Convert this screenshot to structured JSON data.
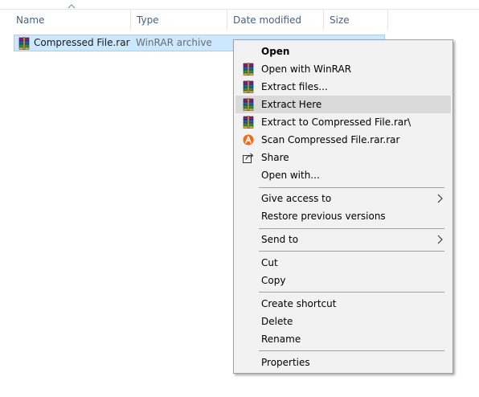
{
  "columns": {
    "name": "Name",
    "type": "Type",
    "date_modified": "Date modified",
    "size": "Size"
  },
  "sort": {
    "column": "name",
    "direction": "ascending"
  },
  "file": {
    "name": "Compressed File.rar",
    "type": "WinRAR archive",
    "icon": "winrar-archive-icon",
    "selected": true
  },
  "context_menu": {
    "hovered_item": "Extract Here",
    "items": [
      {
        "label": "Open",
        "bold": true
      },
      {
        "label": "Open with WinRAR",
        "icon": "winrar-icon"
      },
      {
        "label": "Extract files...",
        "icon": "winrar-icon"
      },
      {
        "label": "Extract Here",
        "icon": "winrar-icon"
      },
      {
        "label": "Extract to Compressed File.rar\\",
        "icon": "winrar-icon"
      },
      {
        "label": "Scan Compressed File.rar.rar",
        "icon": "avast-icon"
      },
      {
        "label": "Share",
        "icon": "share-icon"
      },
      {
        "label": "Open with..."
      },
      {
        "label": "Give access to",
        "submenu": true
      },
      {
        "label": "Restore previous versions"
      },
      {
        "label": "Send to",
        "submenu": true
      },
      {
        "label": "Cut"
      },
      {
        "label": "Copy"
      },
      {
        "label": "Create shortcut"
      },
      {
        "label": "Delete"
      },
      {
        "label": "Rename"
      },
      {
        "label": "Properties"
      }
    ]
  },
  "colors": {
    "selection_fill": "#cce8ff",
    "selection_border": "#99d1ff",
    "menu_background": "#f2f2f2",
    "menu_hover": "#dadada",
    "column_header_text": "#4c607a",
    "avast_orange": "#f26a1b"
  }
}
